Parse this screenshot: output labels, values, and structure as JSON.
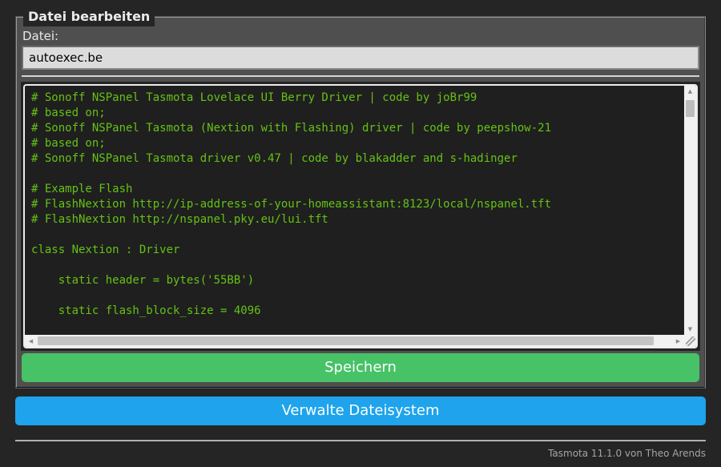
{
  "editor": {
    "legend": "Datei bearbeiten",
    "file_label": "Datei:",
    "filename": "autoexec.be",
    "save_button_label": "Speichern"
  },
  "code": {
    "lines": [
      "# Sonoff NSPanel Tasmota Lovelace UI Berry Driver | code by joBr99",
      "# based on;",
      "# Sonoff NSPanel Tasmota (Nextion with Flashing) driver | code by peepshow-21",
      "# based on;",
      "# Sonoff NSPanel Tasmota driver v0.47 | code by blakadder and s-hadinger",
      "",
      "# Example Flash",
      "# FlashNextion http://ip-address-of-your-homeassistant:8123/local/nspanel.tft",
      "# FlashNextion http://nspanel.pky.eu/lui.tft",
      "",
      "class Nextion : Driver",
      "",
      "    static header = bytes('55BB')",
      "",
      "    static flash_block_size = 4096"
    ]
  },
  "filesystem": {
    "manage_button_label": "Verwalte Dateisystem"
  },
  "footer": {
    "version_text": "Tasmota 11.1.0 von Theo Arends"
  },
  "icons": {
    "scroll_up": "▲",
    "scroll_down": "▼",
    "scroll_left": "◀",
    "scroll_right": "▶"
  },
  "colors": {
    "page_background": "#252525",
    "form_background": "#4f4f4f",
    "console_background": "#1f1f1f",
    "console_text": "#65c115",
    "save_button": "#47c266",
    "manage_button": "#1fa3ec",
    "button_text": "#faffff"
  }
}
